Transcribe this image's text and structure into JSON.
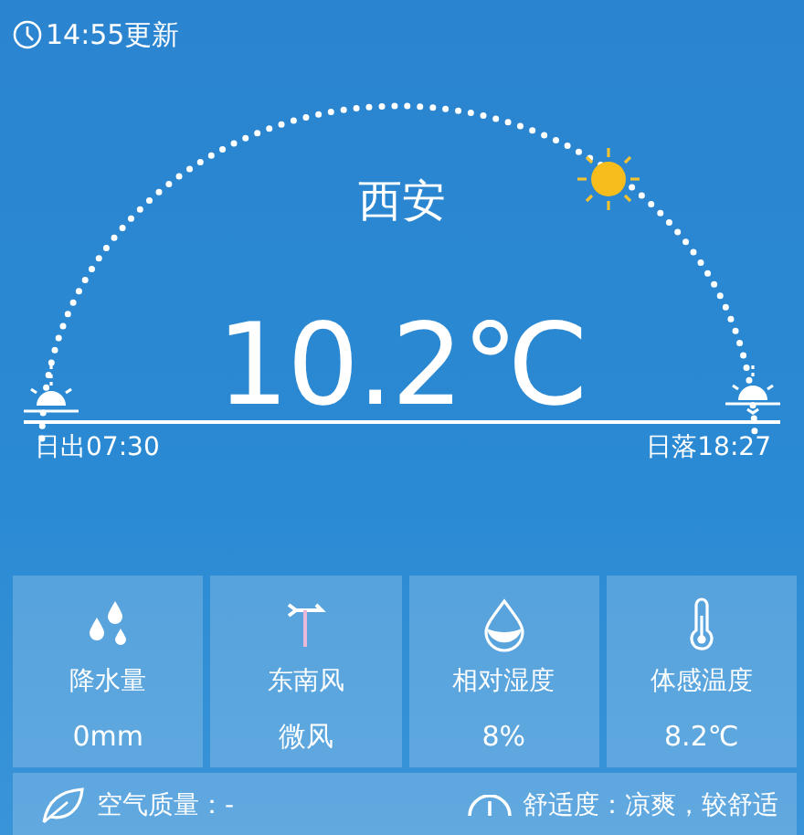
{
  "update_time": "14:55更新",
  "city": "西安",
  "temperature": "10.2℃",
  "sunrise": "日出07:30",
  "sunset": "日落18:27",
  "details": [
    {
      "kind": "rain",
      "label": "降水量",
      "value": "0mm"
    },
    {
      "kind": "wind",
      "label": "东南风",
      "value": "微风"
    },
    {
      "kind": "humidity",
      "label": "相对湿度",
      "value": "8%"
    },
    {
      "kind": "feels",
      "label": "体感温度",
      "value": "8.2℃"
    }
  ],
  "air_quality": "空气质量：-",
  "comfort": "舒适度：凉爽，较舒适"
}
